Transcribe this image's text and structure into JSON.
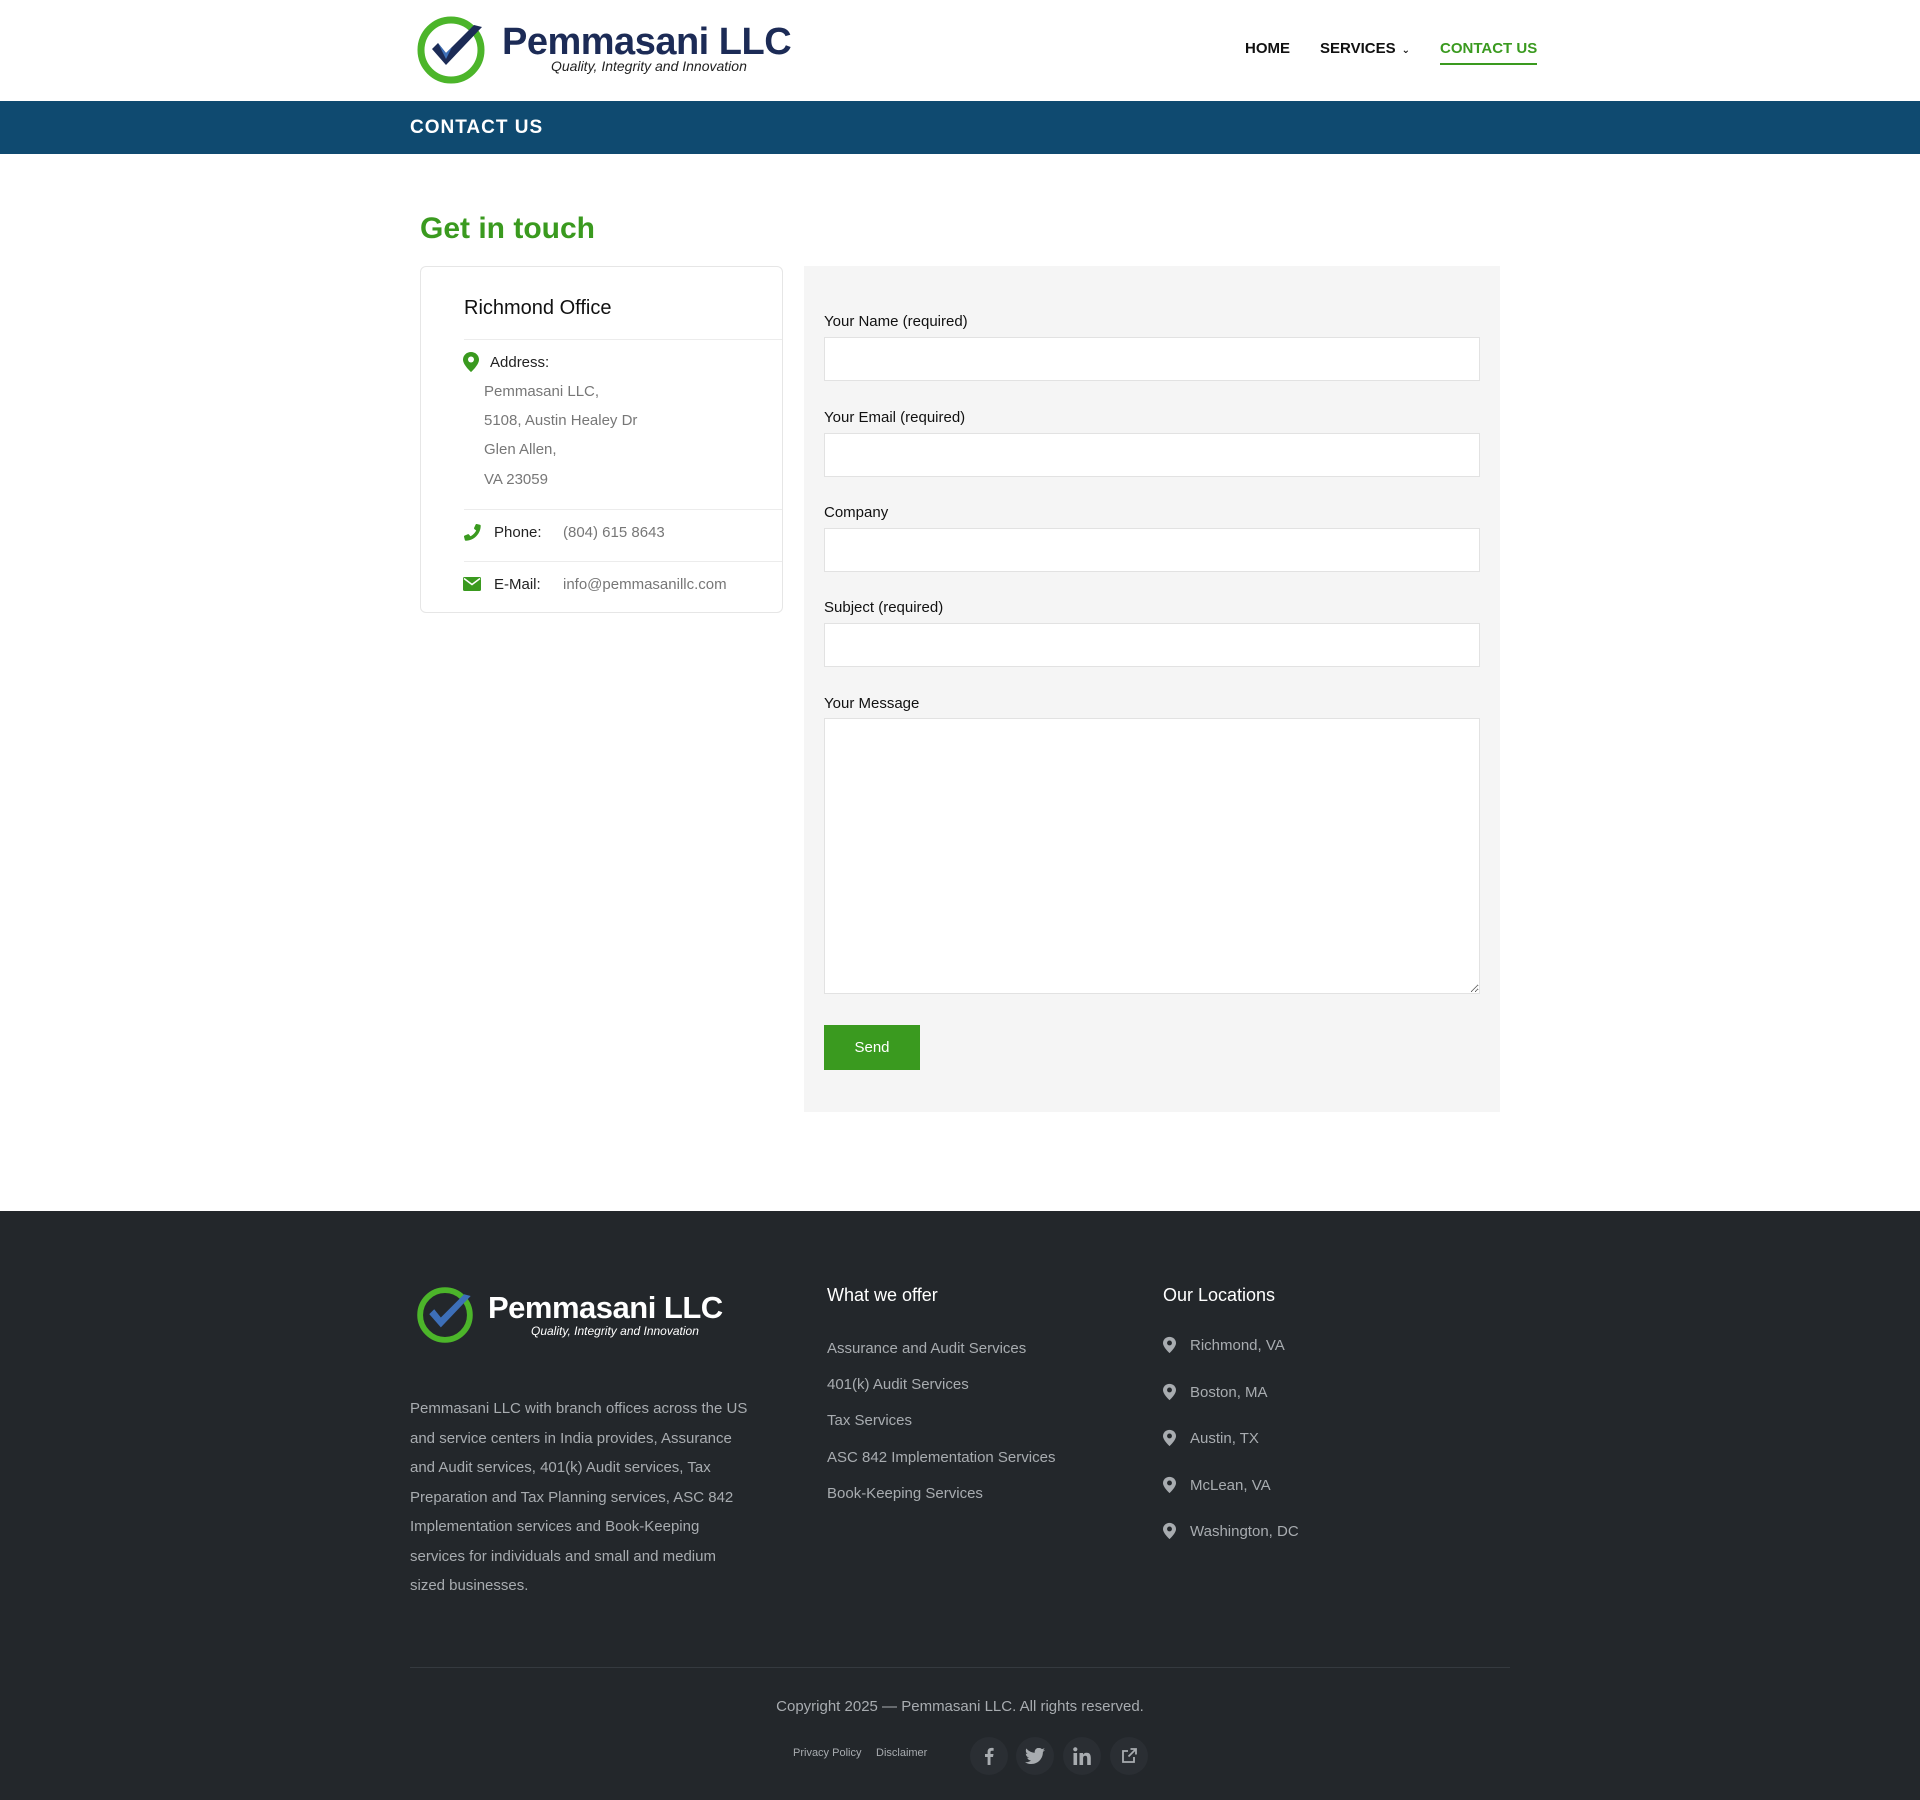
{
  "brand": {
    "name": "Pemmasani LLC",
    "tagline": "Quality, Integrity and Innovation",
    "colors": {
      "navy": "#1c2b56",
      "green": "#3a9a1f",
      "titlebar": "#0f4a70",
      "footer": "#23272b"
    }
  },
  "nav": {
    "items": [
      {
        "label": "HOME"
      },
      {
        "label": "SERVICES"
      },
      {
        "label": "CONTACT US"
      }
    ],
    "active": "CONTACT US"
  },
  "page": {
    "title": "CONTACT US",
    "section_title": "Get in touch"
  },
  "office": {
    "title": "Richmond Office",
    "address_label": "Address:",
    "address_lines": [
      "Pemmasani LLC,",
      "5108, Austin Healey Dr",
      "Glen Allen,",
      "VA 23059"
    ],
    "phone_label": "Phone:",
    "phone": "(804) 615 8643",
    "email_label": "E-Mail:",
    "email": "info@pemmasanillc.com",
    "icons": {
      "address": "map-pin-icon",
      "phone": "phone-icon",
      "email": "envelope-icon"
    }
  },
  "form": {
    "name_label": "Your Name (required)",
    "name_value": "",
    "email_label": "Your Email (required)",
    "email_value": "",
    "company_label": "Company",
    "company_value": "",
    "subject_label": "Subject (required)",
    "subject_value": "",
    "message_label": "Your Message",
    "message_value": "",
    "send_label": "Send"
  },
  "footer": {
    "about": "Pemmasani LLC with branch offices across the US and service centers in India provides, Assurance and Audit services, 401(k) Audit services, Tax Preparation and Tax Planning services, ASC 842 Implementation services and Book-Keeping services for individuals and small and medium sized businesses.",
    "offer_title": "What we offer",
    "offers": [
      "Assurance and Audit Services",
      "401(k) Audit Services",
      "Tax Services",
      "ASC 842 Implementation Services",
      "Book-Keeping Services"
    ],
    "locations_title": "Our Locations",
    "locations": [
      "Richmond, VA",
      "Boston, MA",
      "Austin, TX",
      "McLean, VA",
      "Washington, DC"
    ],
    "copyright": "Copyright 2025 — Pemmasani LLC. All rights reserved.",
    "privacy_label": "Privacy Policy",
    "disclaimer_label": "Disclaimer",
    "social_icons": [
      "facebook-icon",
      "twitter-icon",
      "linkedin-icon",
      "external-link-icon"
    ]
  }
}
